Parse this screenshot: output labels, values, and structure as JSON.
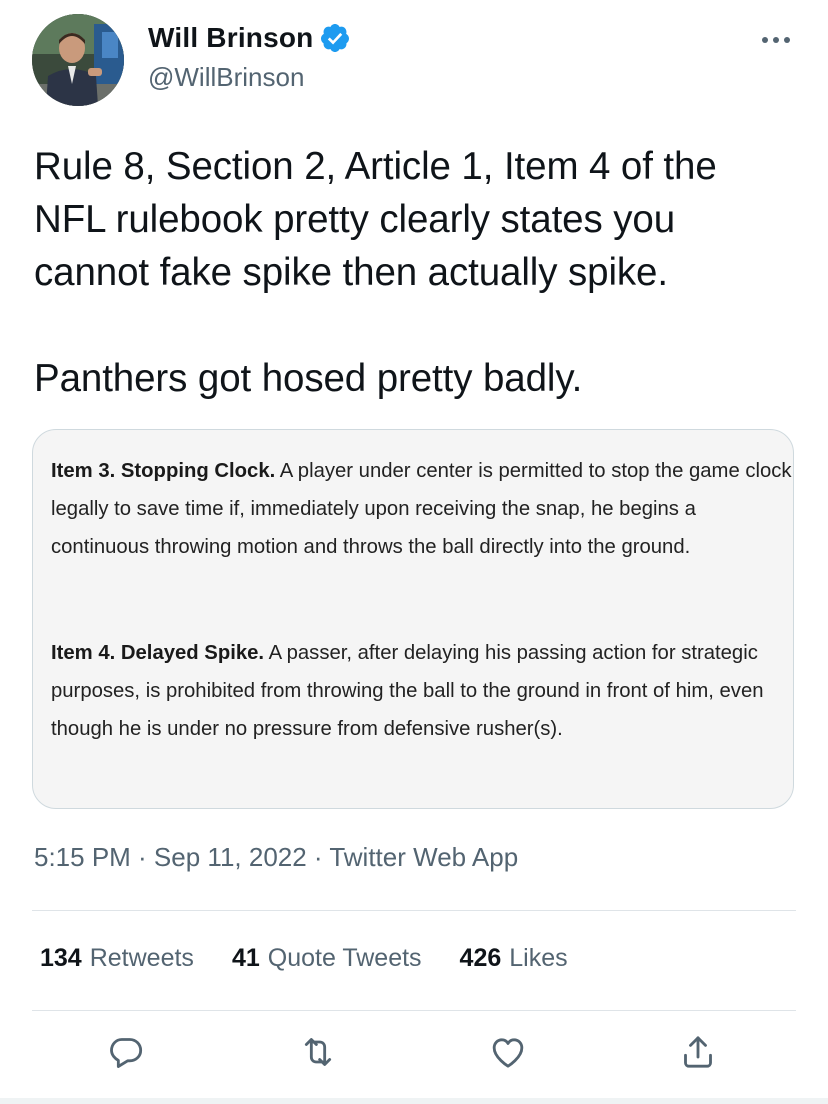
{
  "author": {
    "display_name": "Will Brinson",
    "handle": "@WillBrinson",
    "verified": true,
    "avatar": "avatar-photo"
  },
  "tweet": {
    "text": "Rule 8, Section 2, Article 1, Item 4 of the\nNFL rulebook pretty clearly states you\ncannot fake spike then actually spike.\n\nPanthers got hosed pretty badly."
  },
  "quote_image": {
    "items": [
      {
        "title": "Item 3. Stopping Clock.",
        "body": " A player under center is permitted to stop the game clock legally to save time if, immediately upon receiving the snap, he begins a continuous throwing motion and throws the ball directly into the ground."
      },
      {
        "title": "Item 4. Delayed Spike.",
        "body": " A passer, after delaying his passing action for strategic purposes, is prohibited from throwing the ball to the ground in front of him, even though he is under no pressure from defensive rusher(s)."
      }
    ]
  },
  "meta": {
    "timestamp": "5:15 PM · Sep 11, 2022 · Twitter Web App"
  },
  "stats": [
    {
      "count": "134",
      "label": "Retweets"
    },
    {
      "count": "41",
      "label": "Quote Tweets"
    },
    {
      "count": "426",
      "label": "Likes"
    }
  ],
  "actions": [
    "reply-icon",
    "retweet-icon",
    "like-icon",
    "share-icon"
  ],
  "colors": {
    "verified_blue": "#1d9bf0",
    "text_primary": "#0f1419",
    "text_secondary": "#536471",
    "card_bg": "#f5f5f5",
    "border": "#cfd9de"
  }
}
